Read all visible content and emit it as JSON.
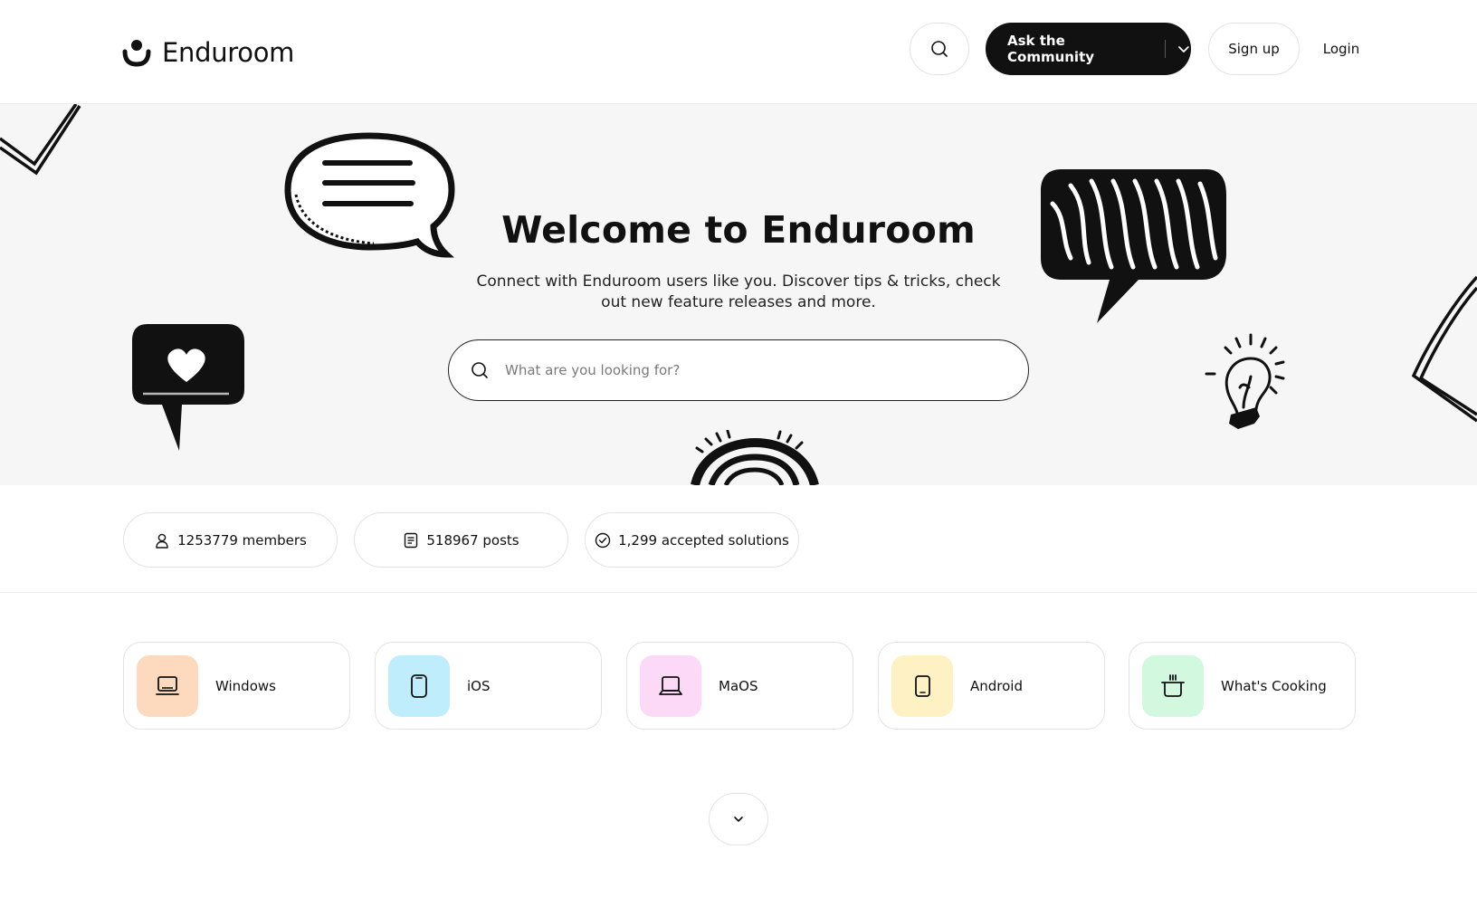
{
  "header": {
    "logo_text": "Enduroom",
    "ask_label": "Ask the Community",
    "signup_label": "Sign up",
    "login_label": "Login"
  },
  "hero": {
    "title": "Welcome to Enduroom",
    "subtitle": "Connect with Enduroom users like you. Discover tips & tricks, check out new feature releases and more.",
    "search_placeholder": "What are you looking for?",
    "search_value": ""
  },
  "stats": [
    {
      "icon": "user-icon",
      "text": "1253779 members"
    },
    {
      "icon": "document-icon",
      "text": "518967 posts"
    },
    {
      "icon": "check-circle-icon",
      "text": "1,299 accepted solutions"
    }
  ],
  "categories": [
    {
      "label": "Windows",
      "icon": "laptop-icon",
      "color": "#fdd9bd"
    },
    {
      "label": "iOS",
      "icon": "phone-icon",
      "color": "#c0edfb"
    },
    {
      "label": "MaOS",
      "icon": "laptop-open-icon",
      "color": "#fcd9f6"
    },
    {
      "label": "Android",
      "icon": "tablet-icon",
      "color": "#fef1c4"
    },
    {
      "label": "What's Cooking",
      "icon": "cooking-pot-icon",
      "color": "#d2f9df"
    }
  ],
  "colors": {
    "primary": "#111111",
    "hero_background": "#f6f6f6",
    "border": "#e3e3e3"
  }
}
